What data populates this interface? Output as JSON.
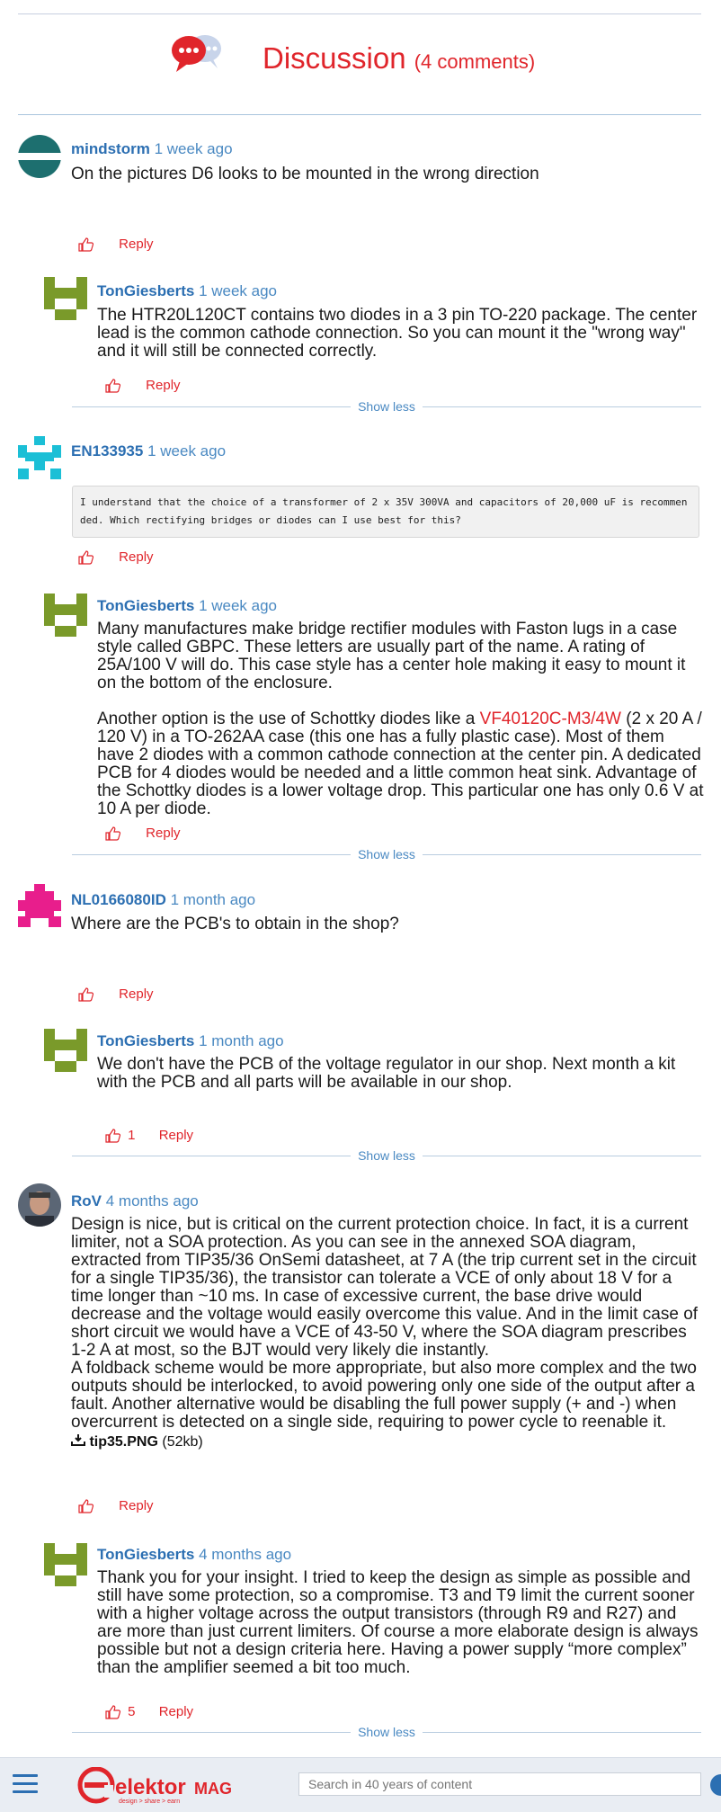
{
  "header": {
    "title": "Discussion",
    "count": "(4 comments)"
  },
  "comments": [
    {
      "author": "mindstorm",
      "time": "1 week ago",
      "text": "On the pictures D6 looks to be mounted in the wrong direction",
      "reply_label": "Reply"
    },
    {
      "author": "TonGiesberts",
      "time": "1 week ago",
      "text": "The HTR20L120CT contains two diodes in a 3 pin TO-220 package. The center lead is the common cathode connection. So you can mount it the \"wrong way\" and it will still be connected correctly.",
      "reply_label": "Reply"
    },
    {
      "author": "EN133935",
      "time": "1 week ago",
      "code": "I understand that the choice of a transformer of 2 x 35V 300VA and capacitors of 20,000 uF is recommended. Which rectifying bridges or diodes can I use best for this?",
      "reply_label": "Reply"
    },
    {
      "author": "TonGiesberts",
      "time": "1 week ago",
      "p1": "Many manufactures make bridge rectifier modules with Faston lugs in a case style called GBPC. These letters are usually part of the name. A rating of 25A/100 V will do. This case style has a center hole making it easy to mount it on the bottom of the enclosure.",
      "p2_before": "Another option is the use of Schottky diodes like a ",
      "p2_link": "VF40120C-M3/4W",
      "p2_after": " (2 x 20 A / 120 V) in a TO-262AA case (this one has a fully plastic case). Most of them have 2 diodes with a common cathode connection at the center pin. A dedicated PCB for 4 diodes would be needed and a little common heat sink. Advantage of the Schottky diodes is a lower voltage drop. This particular one has only 0.6 V at 10 A per diode.",
      "reply_label": "Reply"
    },
    {
      "author": "NL0166080ID",
      "time": "1 month ago",
      "text": "Where are the PCB's to obtain in the shop?",
      "reply_label": "Reply"
    },
    {
      "author": "TonGiesberts",
      "time": "1 month ago",
      "text": "We don't have the PCB of the voltage regulator in our shop. Next month a kit with the PCB and all parts will be available in our shop.",
      "likes": "1",
      "reply_label": "Reply"
    },
    {
      "author": "RoV",
      "time": "4 months ago",
      "p1": "Design is nice, but is critical on the current protection choice. In fact, it is a current limiter, not a SOA protection. As you can see in the annexed SOA diagram, extracted from TIP35/36 OnSemi datasheet, at 7 A (the trip current set in the circuit for a single TIP35/36), the transistor can tolerate a VCE of only about 18 V for a time longer than ~10 ms. In case of excessive current, the base drive would decrease and the voltage would easily overcome this value. And in the limit case of short circuit we would have a VCE of 43-50 V, where the SOA diagram prescribes 1-2 A at most, so the BJT would very likely die instantly.",
      "p2": "A foldback scheme would be more appropriate, but also more complex and the two outputs should be interlocked, to avoid powering only one side of the output after a fault. Another alternative would be disabling the full power supply (+ and -) when overcurrent is detected on a single side, requiring to power cycle to reenable it.",
      "attachment_name": "tip35.PNG",
      "attachment_size": "(52kb)",
      "reply_label": "Reply"
    },
    {
      "author": "TonGiesberts",
      "time": "4 months ago",
      "text": "Thank you for your insight. I tried to keep the design as simple as possible and still have some protection, so a compromise. T3 and T9 limit the current sooner with a higher voltage across the output transistors (through R9 and R27) and are more than just current limiters. Of course a more elaborate design is always possible but not a design criteria here. Having a power supply “more complex” than the amplifier seemed a bit too much.",
      "likes": "5",
      "reply_label": "Reply"
    }
  ],
  "show_less": "Show less",
  "footer": {
    "search_placeholder": "Search in 40 years of content",
    "logo_text": "elektor",
    "logo_mag": "MAG",
    "logo_tagline": "design > share > earn"
  },
  "colors": {
    "accent_red": "#e0252b",
    "link_blue": "#2c6fb2",
    "avatar_teal": "#1d6f6f",
    "avatar_cyan": "#1bbfd6",
    "avatar_olive": "#7a9a2a",
    "avatar_magenta": "#e81e8c"
  }
}
